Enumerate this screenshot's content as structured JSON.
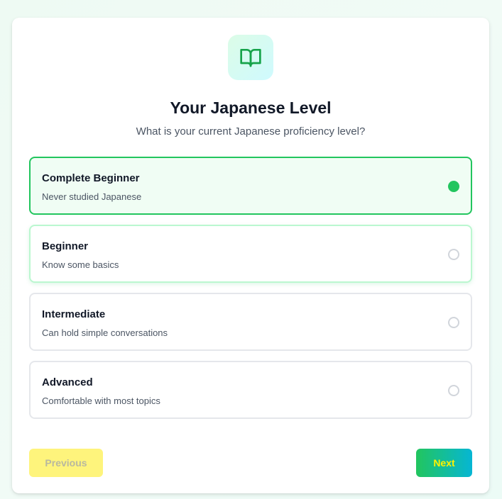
{
  "header": {
    "icon": "book-open-icon",
    "title": "Your Japanese Level",
    "subtitle": "What is your current Japanese proficiency level?"
  },
  "options": [
    {
      "title": "Complete Beginner",
      "description": "Never studied Japanese",
      "selected": true
    },
    {
      "title": "Beginner",
      "description": "Know some basics",
      "selected": false
    },
    {
      "title": "Intermediate",
      "description": "Can hold simple conversations",
      "selected": false
    },
    {
      "title": "Advanced",
      "description": "Comfortable with most topics",
      "selected": false
    }
  ],
  "footer": {
    "previous_label": "Previous",
    "next_label": "Next"
  },
  "colors": {
    "accent": "#22c55e",
    "accent_bg": "#f0fdf4",
    "next_gradient_end": "#06b6d4",
    "previous_bg": "#fef47c",
    "next_text": "#fff200"
  }
}
